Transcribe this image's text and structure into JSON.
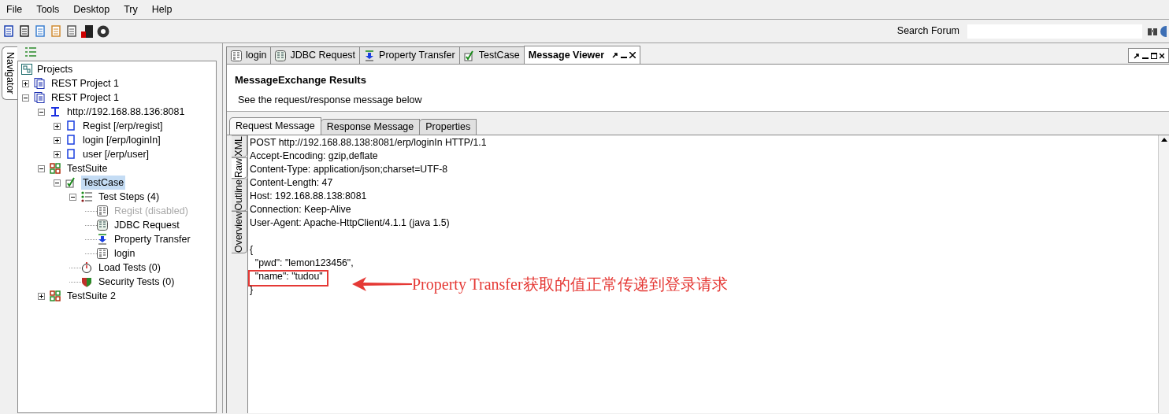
{
  "menu": [
    "File",
    "Tools",
    "Desktop",
    "Try",
    "Help"
  ],
  "search": {
    "label": "Search Forum"
  },
  "navigator": {
    "tab": "Navigator",
    "root": "Projects",
    "tree": [
      {
        "label": "REST Project 1",
        "kind": "project",
        "expanded": false,
        "selected": false,
        "disabled": false
      },
      {
        "label": "REST Project 1",
        "kind": "project",
        "expanded": true,
        "selected": false,
        "disabled": false,
        "children": [
          {
            "label": "http://192.168.88.136:8081",
            "kind": "endpoint",
            "expanded": true,
            "selected": false,
            "disabled": false,
            "children": [
              {
                "label": "Regist [/erp/regist]",
                "kind": "resource",
                "expanded": false,
                "selected": false,
                "disabled": false
              },
              {
                "label": "login [/erp/loginIn]",
                "kind": "resource",
                "expanded": false,
                "selected": false,
                "disabled": false
              },
              {
                "label": "user [/erp/user]",
                "kind": "resource",
                "expanded": false,
                "selected": false,
                "disabled": false
              }
            ]
          },
          {
            "label": "TestSuite",
            "kind": "suite",
            "expanded": true,
            "selected": false,
            "disabled": false,
            "children": [
              {
                "label": "TestCase",
                "kind": "case",
                "expanded": true,
                "selected": true,
                "disabled": false,
                "children": [
                  {
                    "label": "Test Steps (4)",
                    "kind": "steps",
                    "expanded": true,
                    "selected": false,
                    "disabled": false,
                    "children": [
                      {
                        "label": "Regist (disabled)",
                        "kind": "rest",
                        "selected": false,
                        "disabled": true
                      },
                      {
                        "label": "JDBC Request",
                        "kind": "jdbc",
                        "selected": false,
                        "disabled": false
                      },
                      {
                        "label": "Property Transfer",
                        "kind": "transfer",
                        "selected": false,
                        "disabled": false
                      },
                      {
                        "label": "login",
                        "kind": "rest",
                        "selected": false,
                        "disabled": false
                      }
                    ]
                  },
                  {
                    "label": "Load Tests (0)",
                    "kind": "load",
                    "selected": false,
                    "disabled": false
                  },
                  {
                    "label": "Security Tests (0)",
                    "kind": "security",
                    "selected": false,
                    "disabled": false
                  }
                ]
              }
            ]
          },
          {
            "label": "TestSuite 2",
            "kind": "suite",
            "expanded": false,
            "selected": false,
            "disabled": false
          }
        ]
      }
    ]
  },
  "editor_tabs": [
    {
      "label": "login",
      "kind": "rest",
      "selected": false
    },
    {
      "label": "JDBC Request",
      "kind": "jdbc",
      "selected": false
    },
    {
      "label": "Property Transfer",
      "kind": "transfer",
      "selected": false
    },
    {
      "label": "TestCase",
      "kind": "case",
      "selected": false
    },
    {
      "label": "Message Viewer",
      "kind": "viewer",
      "selected": true
    }
  ],
  "viewer": {
    "title": "MessageExchange Results",
    "subtitle": "See the request/response message below",
    "tabs": [
      {
        "label": "Request Message",
        "selected": true
      },
      {
        "label": "Response Message",
        "selected": false
      },
      {
        "label": "Properties",
        "selected": false
      }
    ],
    "side_tabs": [
      {
        "label": "XML",
        "selected": false
      },
      {
        "label": "Raw",
        "selected": true
      },
      {
        "label": "Outline",
        "selected": false
      },
      {
        "label": "Overview",
        "selected": false
      }
    ],
    "headers": [
      "POST http://192.168.88.138:8081/erp/loginIn HTTP/1.1",
      "Accept-Encoding: gzip,deflate",
      "Content-Type: application/json;charset=UTF-8",
      "Content-Length: 47",
      "Host: 192.168.88.138:8081",
      "Connection: Keep-Alive",
      "User-Agent: Apache-HttpClient/4.1.1 (java 1.5)"
    ],
    "body": [
      {
        "text": "{",
        "highlighted": false
      },
      {
        "text": "  \"pwd\": \"lemon123456\",",
        "highlighted": false
      },
      {
        "text": "  \"name\": \"tudou\"",
        "highlighted": true
      },
      {
        "text": "}",
        "highlighted": false
      }
    ]
  },
  "annotation": {
    "text": "Property Transfer获取的值正常传递到登录请求"
  }
}
